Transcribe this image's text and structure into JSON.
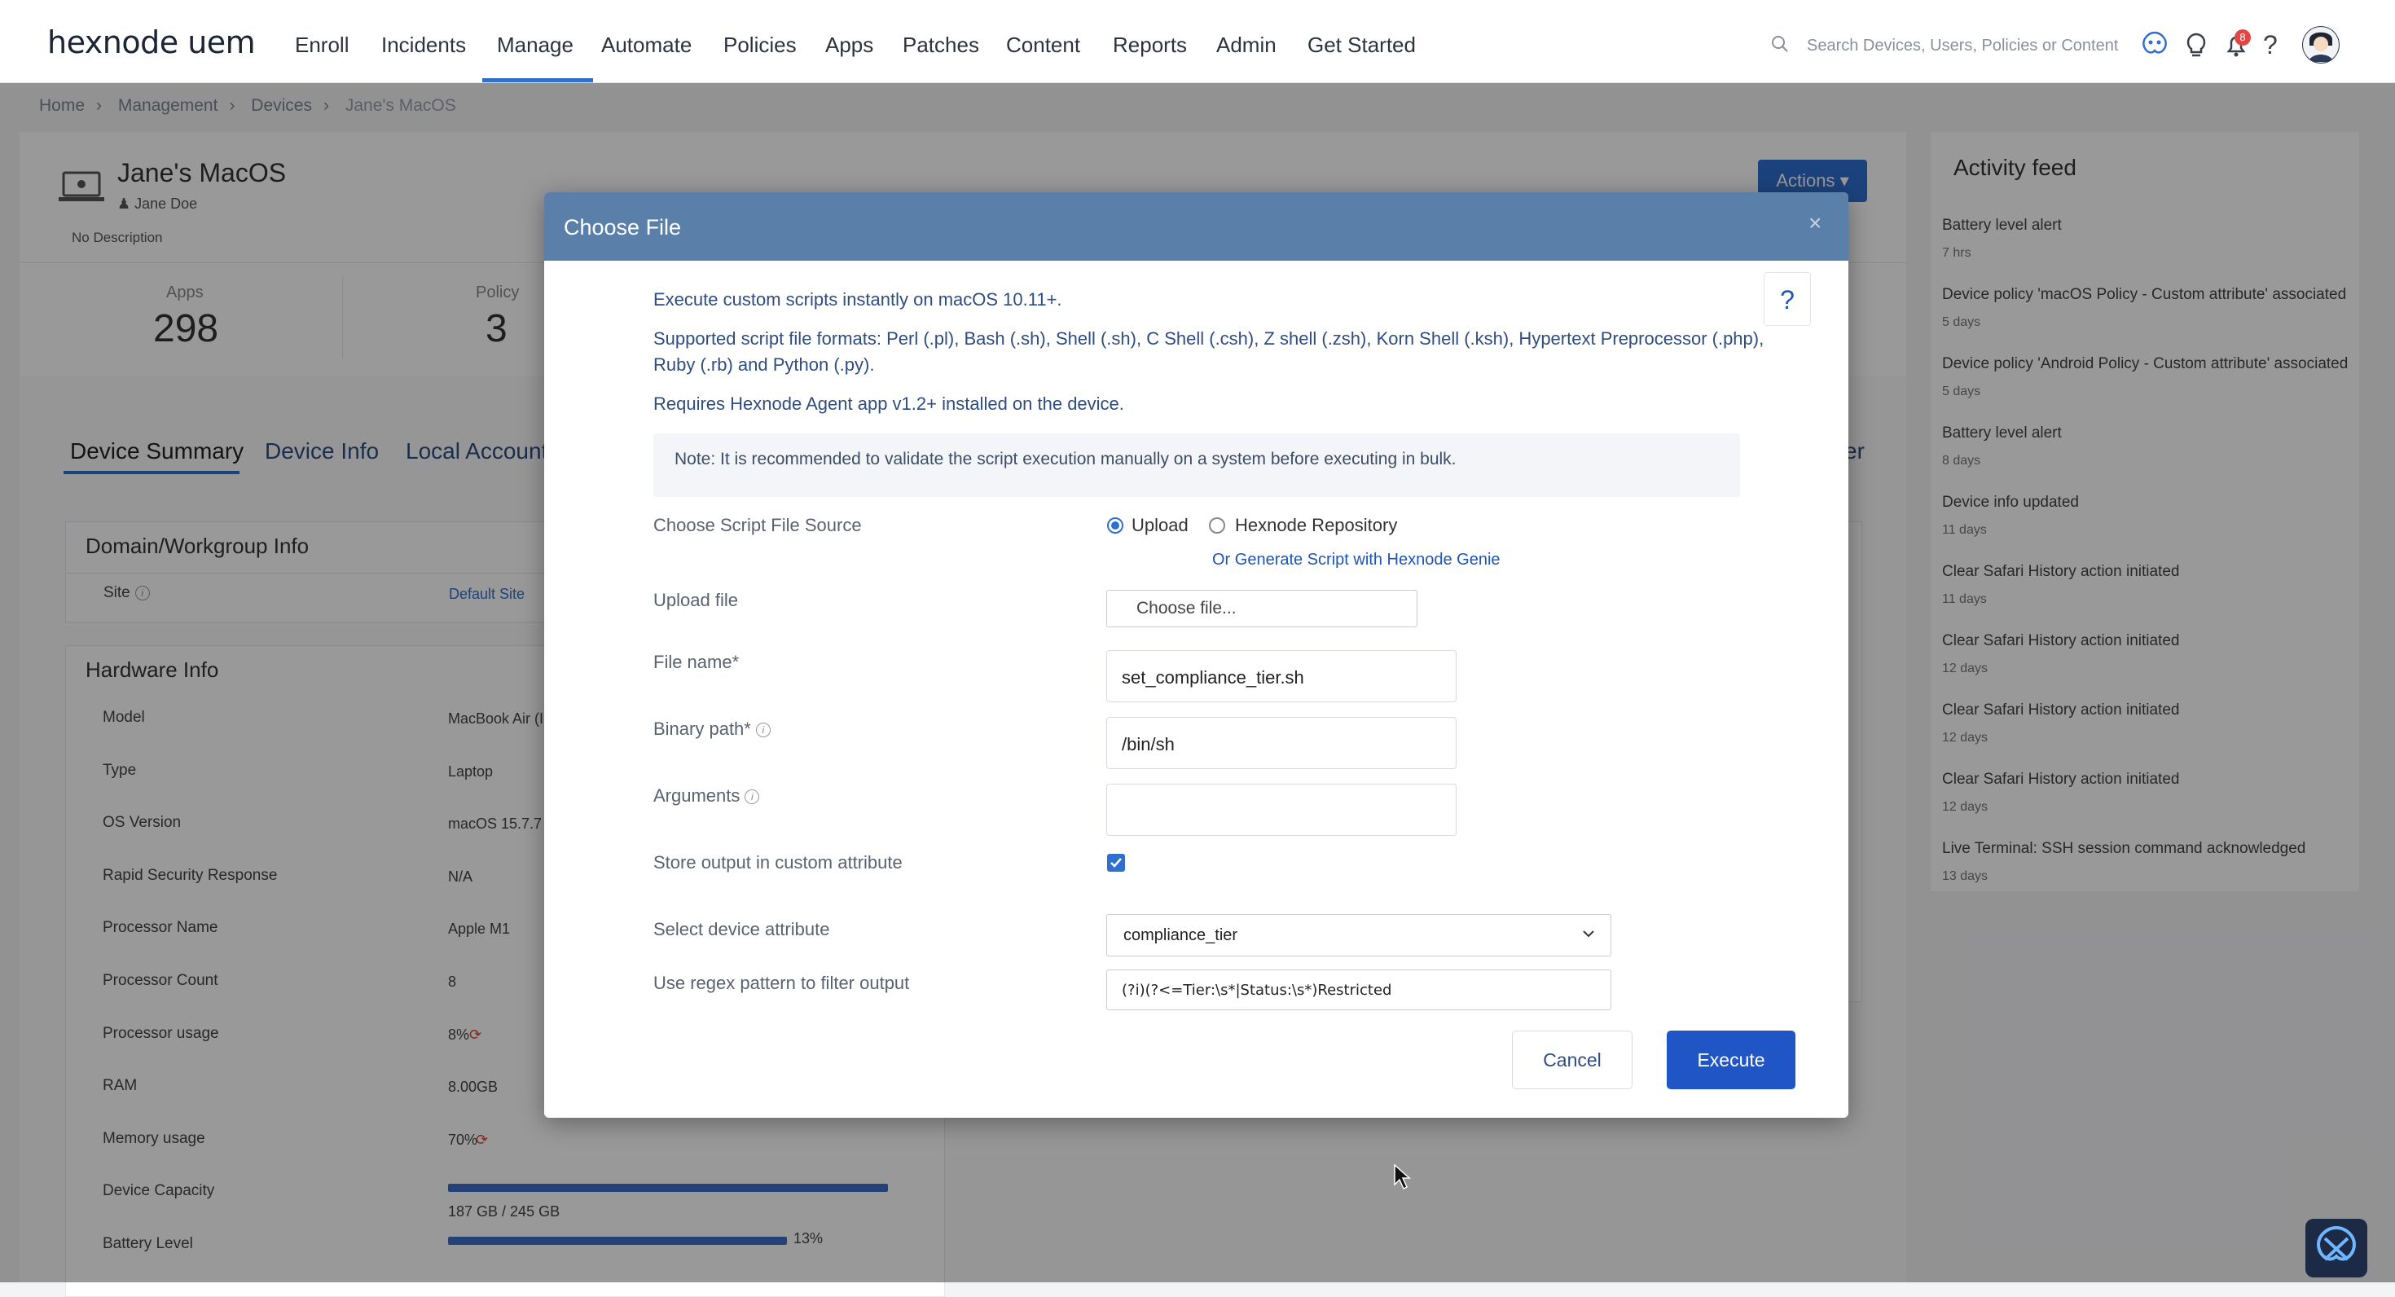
{
  "nav": {
    "logo": "hexnode uem",
    "items": [
      "Enroll",
      "Incidents",
      "Manage",
      "Automate",
      "Policies",
      "Apps",
      "Patches",
      "Content",
      "Reports",
      "Admin",
      "Get Started"
    ],
    "active": "Manage",
    "search_placeholder": "Search Devices, Users, Policies or Content",
    "notification_count": "8"
  },
  "breadcrumb": [
    "Home",
    "Management",
    "Devices",
    "Jane's MacOS"
  ],
  "device": {
    "name": "Jane's MacOS",
    "user": "Jane Doe",
    "description": "No Description",
    "actions_label": "Actions",
    "stats": [
      {
        "label": "Apps",
        "value": "298"
      },
      {
        "label": "Policy",
        "value": "3"
      }
    ],
    "tabs": [
      "Device Summary",
      "Device Info",
      "Local Accounts"
    ],
    "tab_tail": "er",
    "domain_section": "Domain/Workgroup Info",
    "site_label": "Site",
    "site_value": "Default Site",
    "hardware_section": "Hardware Info",
    "hardware": [
      {
        "label": "Model",
        "value": "MacBook Air (I"
      },
      {
        "label": "Type",
        "value": "Laptop"
      },
      {
        "label": "OS Version",
        "value": "macOS 15.7.7 ("
      },
      {
        "label": "Rapid Security Response",
        "value": "N/A"
      },
      {
        "label": "Processor Name",
        "value": "Apple M1"
      },
      {
        "label": "Processor Count",
        "value": "8"
      },
      {
        "label": "Processor usage",
        "value": "8%"
      },
      {
        "label": "RAM",
        "value": "8.00GB"
      },
      {
        "label": "Memory usage",
        "value": "70%"
      },
      {
        "label": "Device Capacity",
        "value": "187 GB / 245 GB"
      },
      {
        "label": "Battery Level",
        "value": "13%"
      }
    ],
    "capacity_fraction": 0.76,
    "battery_fraction": 0.13
  },
  "modal": {
    "title": "Choose File",
    "close": "×",
    "help": "?",
    "intro": "Execute custom scripts instantly on macOS 10.11+.",
    "formats_line1": "Supported script file formats: Perl (.pl), Bash (.sh), Shell (.sh), C Shell (.csh), Z shell (.zsh), Korn Shell (.ksh), Hypertext Preprocessor (.php),",
    "formats_line2": "Ruby (.rb) and Python (.py).",
    "requires": "Requires Hexnode Agent app v1.2+ installed on the device.",
    "note": "Note: It is recommended to validate the script execution manually on a system before executing in bulk.",
    "source_label": "Choose Script File Source",
    "source_upload": "Upload",
    "source_repo": "Hexnode Repository",
    "genie_link": "Or Generate Script with Hexnode Genie",
    "upload_label": "Upload file",
    "upload_button": "Choose file...",
    "filename_label": "File name*",
    "filename_value": "set_compliance_tier.sh",
    "binary_label": "Binary path*",
    "binary_value": "/bin/sh",
    "args_label": "Arguments",
    "args_value": "",
    "store_label": "Store output in custom attribute",
    "store_checked": true,
    "attr_label": "Select device attribute",
    "attr_value": "compliance_tier",
    "regex_label": "Use regex pattern to filter output",
    "regex_value": "(?i)(?<=Tier:\\s*|Status:\\s*)Restricted",
    "cancel": "Cancel",
    "execute": "Execute"
  },
  "feed": {
    "title": "Activity feed",
    "events": [
      {
        "text": "Battery level alert",
        "time": "7 hrs"
      },
      {
        "text": "Device policy 'macOS Policy - Custom attribute' associated",
        "time": "5 days"
      },
      {
        "text": "Device policy 'Android Policy - Custom attribute' associated",
        "time": "5 days"
      },
      {
        "text": "Battery level alert",
        "time": "8 days"
      },
      {
        "text": "Device info updated",
        "time": "11 days"
      },
      {
        "text": "Clear Safari History action initiated",
        "time": "11 days"
      },
      {
        "text": "Clear Safari History action initiated",
        "time": "12 days"
      },
      {
        "text": "Clear Safari History action initiated",
        "time": "12 days"
      },
      {
        "text": "Clear Safari History action initiated",
        "time": "12 days"
      },
      {
        "text": "Live Terminal: SSH session command acknowledged",
        "time": "13 days"
      }
    ]
  }
}
